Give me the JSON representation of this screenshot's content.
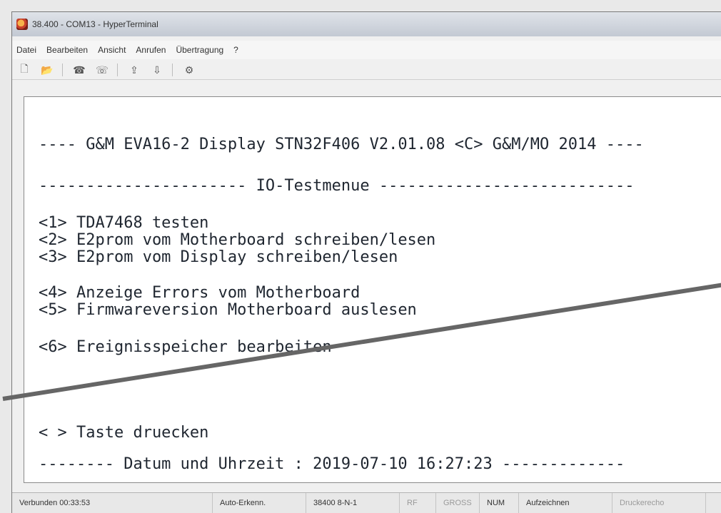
{
  "window": {
    "title": "38.400 - COM13 - HyperTerminal"
  },
  "menu": {
    "items": [
      "Datei",
      "Bearbeiten",
      "Ansicht",
      "Anrufen",
      "Übertragung",
      "?"
    ]
  },
  "toolbar": {
    "icons": [
      "new-document-icon",
      "open-folder-icon",
      "dial-icon",
      "hangup-icon",
      "send-icon",
      "receive-icon",
      "properties-icon"
    ]
  },
  "terminal": {
    "header": "---- G&M EVA16-2 Display STN32F406 V2.01.08 <C> G&M/MO 2014 ----",
    "menu_title": "---------------------- IO-Testmenue ---------------------------",
    "options": [
      "<1> TDA7468 testen",
      "<2> E2prom vom Motherboard schreiben/lesen",
      "<3> E2prom vom Display schreiben/lesen",
      "<4> Anzeige Errors vom Motherboard",
      "<5> Firmwareversion Motherboard auslesen",
      "<6> Ereignisspeicher bearbeiten"
    ],
    "prompt": "< > Taste druecken",
    "footer": "-------- Datum und Uhrzeit : 2019-07-10 16:27:23 -------------"
  },
  "status": {
    "connected": "Verbunden 00:33:53",
    "detect": "Auto-Erkenn.",
    "params": "38400 8-N-1",
    "rf": "RF",
    "caps": "GROSS",
    "num": "NUM",
    "record": "Aufzeichnen",
    "print": "Druckerecho"
  }
}
